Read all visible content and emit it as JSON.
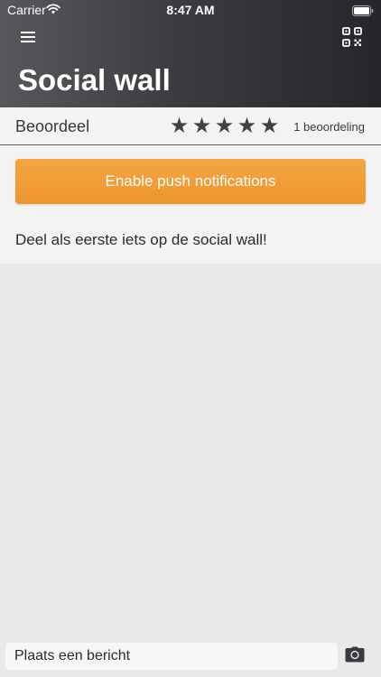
{
  "status_bar": {
    "carrier": "Carrier",
    "time": "8:47 AM"
  },
  "header": {
    "title": "Social wall",
    "menu_icon": "hamburger-menu-icon",
    "qr_icon": "qr-code-icon"
  },
  "rating": {
    "label": "Beoordeel",
    "stars_total": 5,
    "star_glyph": "★",
    "count_text": "1 beoordeling"
  },
  "push_button": {
    "label": "Enable push notifications",
    "color": "#ef9a36"
  },
  "feed": {
    "empty_message": "Deel als eerste iets op de social wall!"
  },
  "composer": {
    "placeholder": "Plaats een bericht",
    "camera_icon": "camera-icon"
  },
  "colors": {
    "header_dark": "#24262a",
    "header_light": "#56585c",
    "accent": "#ef9a36",
    "background": "#e9e9ea"
  }
}
